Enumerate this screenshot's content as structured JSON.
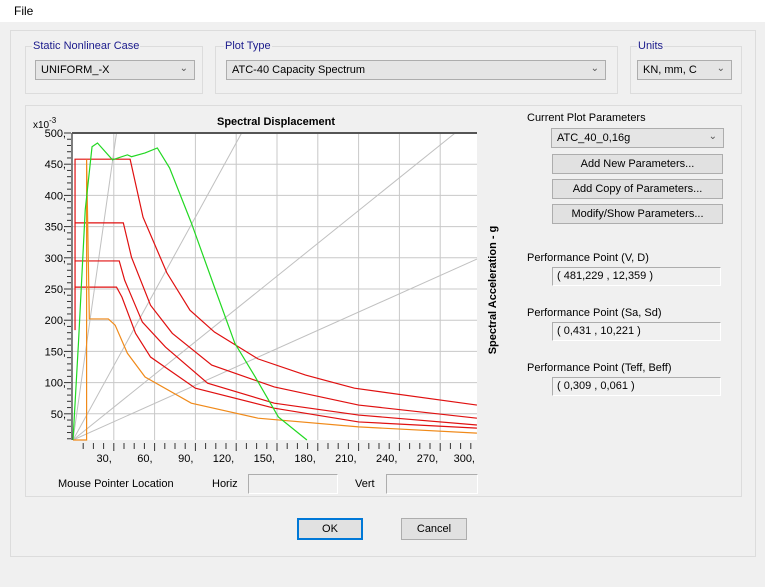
{
  "menu": {
    "file": "File"
  },
  "static_case": {
    "label": "Static Nonlinear Case",
    "value": "UNIFORM_-X"
  },
  "plot_type": {
    "label": "Plot Type",
    "value": "ATC-40 Capacity Spectrum"
  },
  "units": {
    "label": "Units",
    "value": "KN, mm, C"
  },
  "params": {
    "label": "Current Plot Parameters",
    "value": "ATC_40_0,16g",
    "add_new": "Add New Parameters...",
    "add_copy": "Add Copy of Parameters...",
    "modify": "Modify/Show Parameters..."
  },
  "perf": [
    {
      "label": "Performance Point (V, D)",
      "value": "( 481,229 , 12,359 )"
    },
    {
      "label": "Performance Point (Sa, Sd)",
      "value": "( 0,431 , 10,221 )"
    },
    {
      "label": "Performance Point (Teff, Beff)",
      "value": "( 0,309 , 0,061 )"
    }
  ],
  "mouse": {
    "label": "Mouse Pointer Location",
    "horiz": "Horiz",
    "vert": "Vert",
    "horiz_value": "",
    "vert_value": ""
  },
  "buttons": {
    "ok": "OK",
    "cancel": "Cancel"
  },
  "chart_data": {
    "type": "line",
    "title": "Spectral Displacement",
    "ylabel": "Spectral Acceleration - g",
    "y_multiplier": "x10 -3",
    "xlim": [
      0,
      298
    ],
    "ylim": [
      8,
      500
    ],
    "grid": true,
    "x_ticks": [
      30,
      60,
      90,
      120,
      150,
      180,
      210,
      240,
      270,
      300
    ],
    "x_tick_labels": [
      "30,",
      "60,",
      "90,",
      "120,",
      "150,",
      "180,",
      "210,",
      "240,",
      "270,",
      "300,"
    ],
    "y_ticks": [
      50,
      100,
      150,
      200,
      250,
      300,
      350,
      400,
      450,
      500
    ],
    "y_tick_labels": [
      "50,",
      "100,",
      "150,",
      "200,",
      "250,",
      "300,",
      "350,",
      "400,",
      "450,",
      "500,"
    ],
    "colors": {
      "demand": "#e01010",
      "demand_reduced": "#f08a1a",
      "capacity": "#22d822",
      "period_lines": "#c0c0c0"
    },
    "series": [
      {
        "color": "#e01010",
        "points": [
          [
            1.5,
            184
          ],
          [
            1.5,
            458
          ],
          [
            42,
            458
          ],
          [
            51.5,
            365
          ],
          [
            69,
            276
          ],
          [
            86,
            216
          ],
          [
            104,
            181
          ],
          [
            136,
            138
          ],
          [
            171,
            112
          ],
          [
            207,
            91
          ],
          [
            297,
            64
          ]
        ]
      },
      {
        "color": "#e01010",
        "points": [
          [
            1.5,
            356
          ],
          [
            37,
            356
          ],
          [
            43,
            301
          ],
          [
            57,
            224
          ],
          [
            73,
            179
          ],
          [
            102,
            128
          ],
          [
            148,
            93
          ],
          [
            210,
            64
          ],
          [
            297,
            43
          ]
        ]
      },
      {
        "color": "#e01010",
        "points": [
          [
            1.5,
            295
          ],
          [
            34,
            295
          ],
          [
            38,
            264
          ],
          [
            51,
            197
          ],
          [
            68,
            157
          ],
          [
            99,
            99
          ],
          [
            148,
            67
          ],
          [
            210,
            48
          ],
          [
            297,
            32
          ]
        ]
      },
      {
        "color": "#e01010",
        "points": [
          [
            1.5,
            253
          ],
          [
            32,
            253
          ],
          [
            36,
            237
          ],
          [
            46,
            179
          ],
          [
            57,
            141
          ],
          [
            90,
            91
          ],
          [
            148,
            59
          ],
          [
            210,
            37
          ],
          [
            297,
            27
          ]
        ]
      },
      {
        "color": "#f08a1a",
        "points": [
          [
            0,
            8
          ],
          [
            10,
            8
          ],
          [
            10,
            458
          ],
          [
            12,
            202
          ],
          [
            26,
            202
          ],
          [
            31,
            192
          ],
          [
            40,
            147
          ],
          [
            53,
            109
          ],
          [
            87,
            67
          ],
          [
            136,
            43
          ],
          [
            210,
            29
          ],
          [
            297,
            19
          ]
        ]
      },
      {
        "color": "#22d822",
        "points": [
          [
            0,
            8
          ],
          [
            4,
            163
          ],
          [
            9,
            377
          ],
          [
            14,
            478
          ],
          [
            18,
            484
          ],
          [
            29,
            457
          ],
          [
            40,
            465
          ],
          [
            43,
            462
          ],
          [
            53,
            468
          ],
          [
            62,
            476
          ],
          [
            71,
            444
          ],
          [
            87,
            356
          ],
          [
            104,
            253
          ],
          [
            119,
            163
          ],
          [
            134,
            109
          ],
          [
            151,
            45
          ],
          [
            172,
            8
          ]
        ]
      }
    ],
    "period_lines": [
      [
        [
          0,
          8
        ],
        [
          32,
          500
        ]
      ],
      [
        [
          0,
          8
        ],
        [
          124,
          500
        ]
      ],
      [
        [
          0,
          8
        ],
        [
          281,
          500
        ]
      ],
      [
        [
          0,
          8
        ],
        [
          297,
          298
        ]
      ]
    ]
  }
}
